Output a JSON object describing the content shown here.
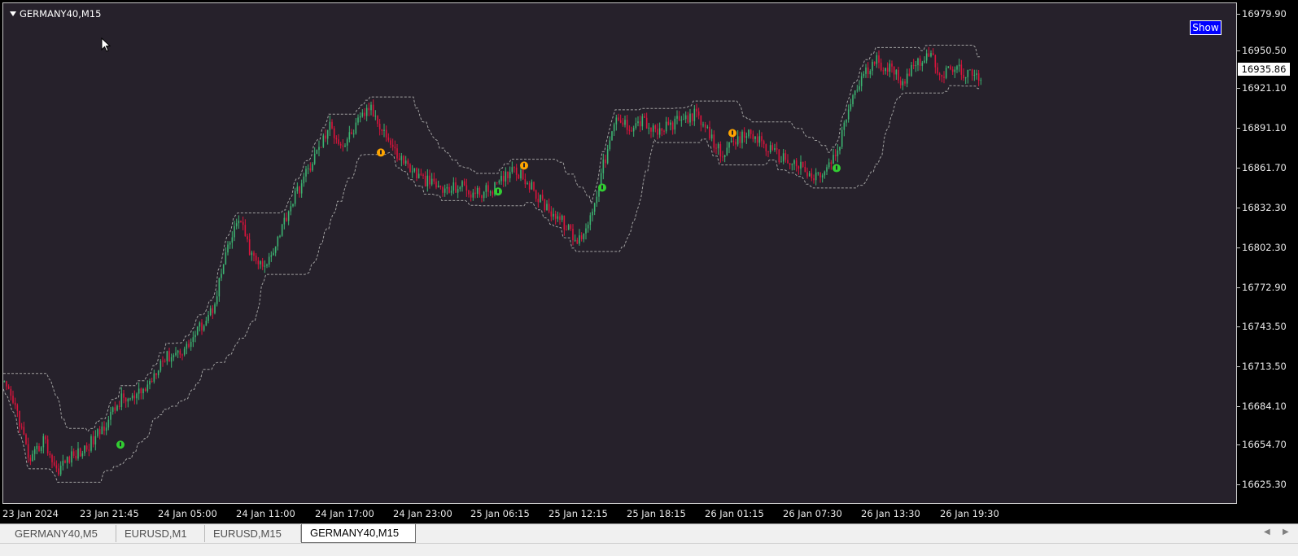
{
  "window": {
    "symbol_title": "GERMANY40,M15",
    "show_button": "Show",
    "current_price": "16935.86"
  },
  "price_axis": {
    "ticks": [
      "16979.90",
      "16950.50",
      "16921.10",
      "16891.10",
      "16861.70",
      "16832.30",
      "16802.30",
      "16772.90",
      "16743.50",
      "16713.50",
      "16684.10",
      "16654.70",
      "16625.30"
    ]
  },
  "time_axis": {
    "ticks": [
      "23 Jan 2024",
      "23 Jan 21:45",
      "24 Jan 05:00",
      "24 Jan 11:00",
      "24 Jan 17:00",
      "24 Jan 23:00",
      "25 Jan 06:15",
      "25 Jan 12:15",
      "25 Jan 18:15",
      "26 Jan 01:15",
      "26 Jan 07:30",
      "26 Jan 13:30",
      "26 Jan 19:30"
    ]
  },
  "tabs": [
    {
      "label": "GERMANY40,M5",
      "active": false
    },
    {
      "label": "EURUSD,M1",
      "active": false
    },
    {
      "label": "EURUSD,M15",
      "active": false
    },
    {
      "label": "GERMANY40,M15",
      "active": true
    }
  ],
  "colors": {
    "background": "#26212b",
    "bull_candle": "#3cb371",
    "bear_candle": "#dc143c",
    "channel": "#a0a0a0",
    "buy_signal": "#32cd32",
    "sell_signal": "#ffa500"
  },
  "chart_data": {
    "type": "candlestick",
    "y_axis_range": [
      16610,
      16995
    ],
    "close_path": [
      [
        0,
        16700
      ],
      [
        1,
        16680
      ],
      [
        2,
        16640
      ],
      [
        3,
        16660
      ],
      [
        4,
        16635
      ],
      [
        5,
        16645
      ],
      [
        6,
        16650
      ],
      [
        7,
        16660
      ],
      [
        8,
        16675
      ],
      [
        9,
        16690
      ],
      [
        10,
        16690
      ],
      [
        11,
        16700
      ],
      [
        12,
        16720
      ],
      [
        13,
        16725
      ],
      [
        14,
        16730
      ],
      [
        15,
        16745
      ],
      [
        16,
        16760
      ],
      [
        17,
        16800
      ],
      [
        18,
        16830
      ],
      [
        19,
        16800
      ],
      [
        20,
        16790
      ],
      [
        21,
        16815
      ],
      [
        22,
        16840
      ],
      [
        23,
        16860
      ],
      [
        24,
        16880
      ],
      [
        25,
        16900
      ],
      [
        26,
        16885
      ],
      [
        27,
        16900
      ],
      [
        28,
        16915
      ],
      [
        29,
        16900
      ],
      [
        30,
        16880
      ],
      [
        31,
        16870
      ],
      [
        32,
        16860
      ],
      [
        33,
        16855
      ],
      [
        34,
        16850
      ],
      [
        35,
        16855
      ],
      [
        36,
        16848
      ],
      [
        37,
        16850
      ],
      [
        38,
        16855
      ],
      [
        39,
        16870
      ],
      [
        40,
        16860
      ],
      [
        41,
        16845
      ],
      [
        42,
        16835
      ],
      [
        43,
        16825
      ],
      [
        44,
        16810
      ],
      [
        45,
        16830
      ],
      [
        46,
        16870
      ],
      [
        47,
        16905
      ],
      [
        48,
        16900
      ],
      [
        49,
        16905
      ],
      [
        50,
        16895
      ],
      [
        51,
        16900
      ],
      [
        52,
        16905
      ],
      [
        53,
        16910
      ],
      [
        54,
        16895
      ],
      [
        55,
        16880
      ],
      [
        56,
        16885
      ],
      [
        57,
        16895
      ],
      [
        58,
        16890
      ],
      [
        59,
        16880
      ],
      [
        60,
        16875
      ],
      [
        61,
        16870
      ],
      [
        62,
        16860
      ],
      [
        63,
        16865
      ],
      [
        64,
        16880
      ],
      [
        65,
        16920
      ],
      [
        66,
        16940
      ],
      [
        67,
        16950
      ],
      [
        68,
        16945
      ],
      [
        69,
        16935
      ],
      [
        70,
        16950
      ],
      [
        71,
        16955
      ],
      [
        72,
        16940
      ],
      [
        73,
        16945
      ],
      [
        74,
        16940
      ],
      [
        75,
        16936
      ]
    ],
    "signals": [
      {
        "type": "buy",
        "i": 9,
        "price": 16655
      },
      {
        "type": "sell",
        "i": 29,
        "price": 16880
      },
      {
        "type": "buy",
        "i": 38,
        "price": 16850
      },
      {
        "type": "sell",
        "i": 40,
        "price": 16870
      },
      {
        "type": "buy",
        "i": 46,
        "price": 16853
      },
      {
        "type": "sell",
        "i": 56,
        "price": 16895
      },
      {
        "type": "buy",
        "i": 64,
        "price": 16868
      }
    ]
  }
}
